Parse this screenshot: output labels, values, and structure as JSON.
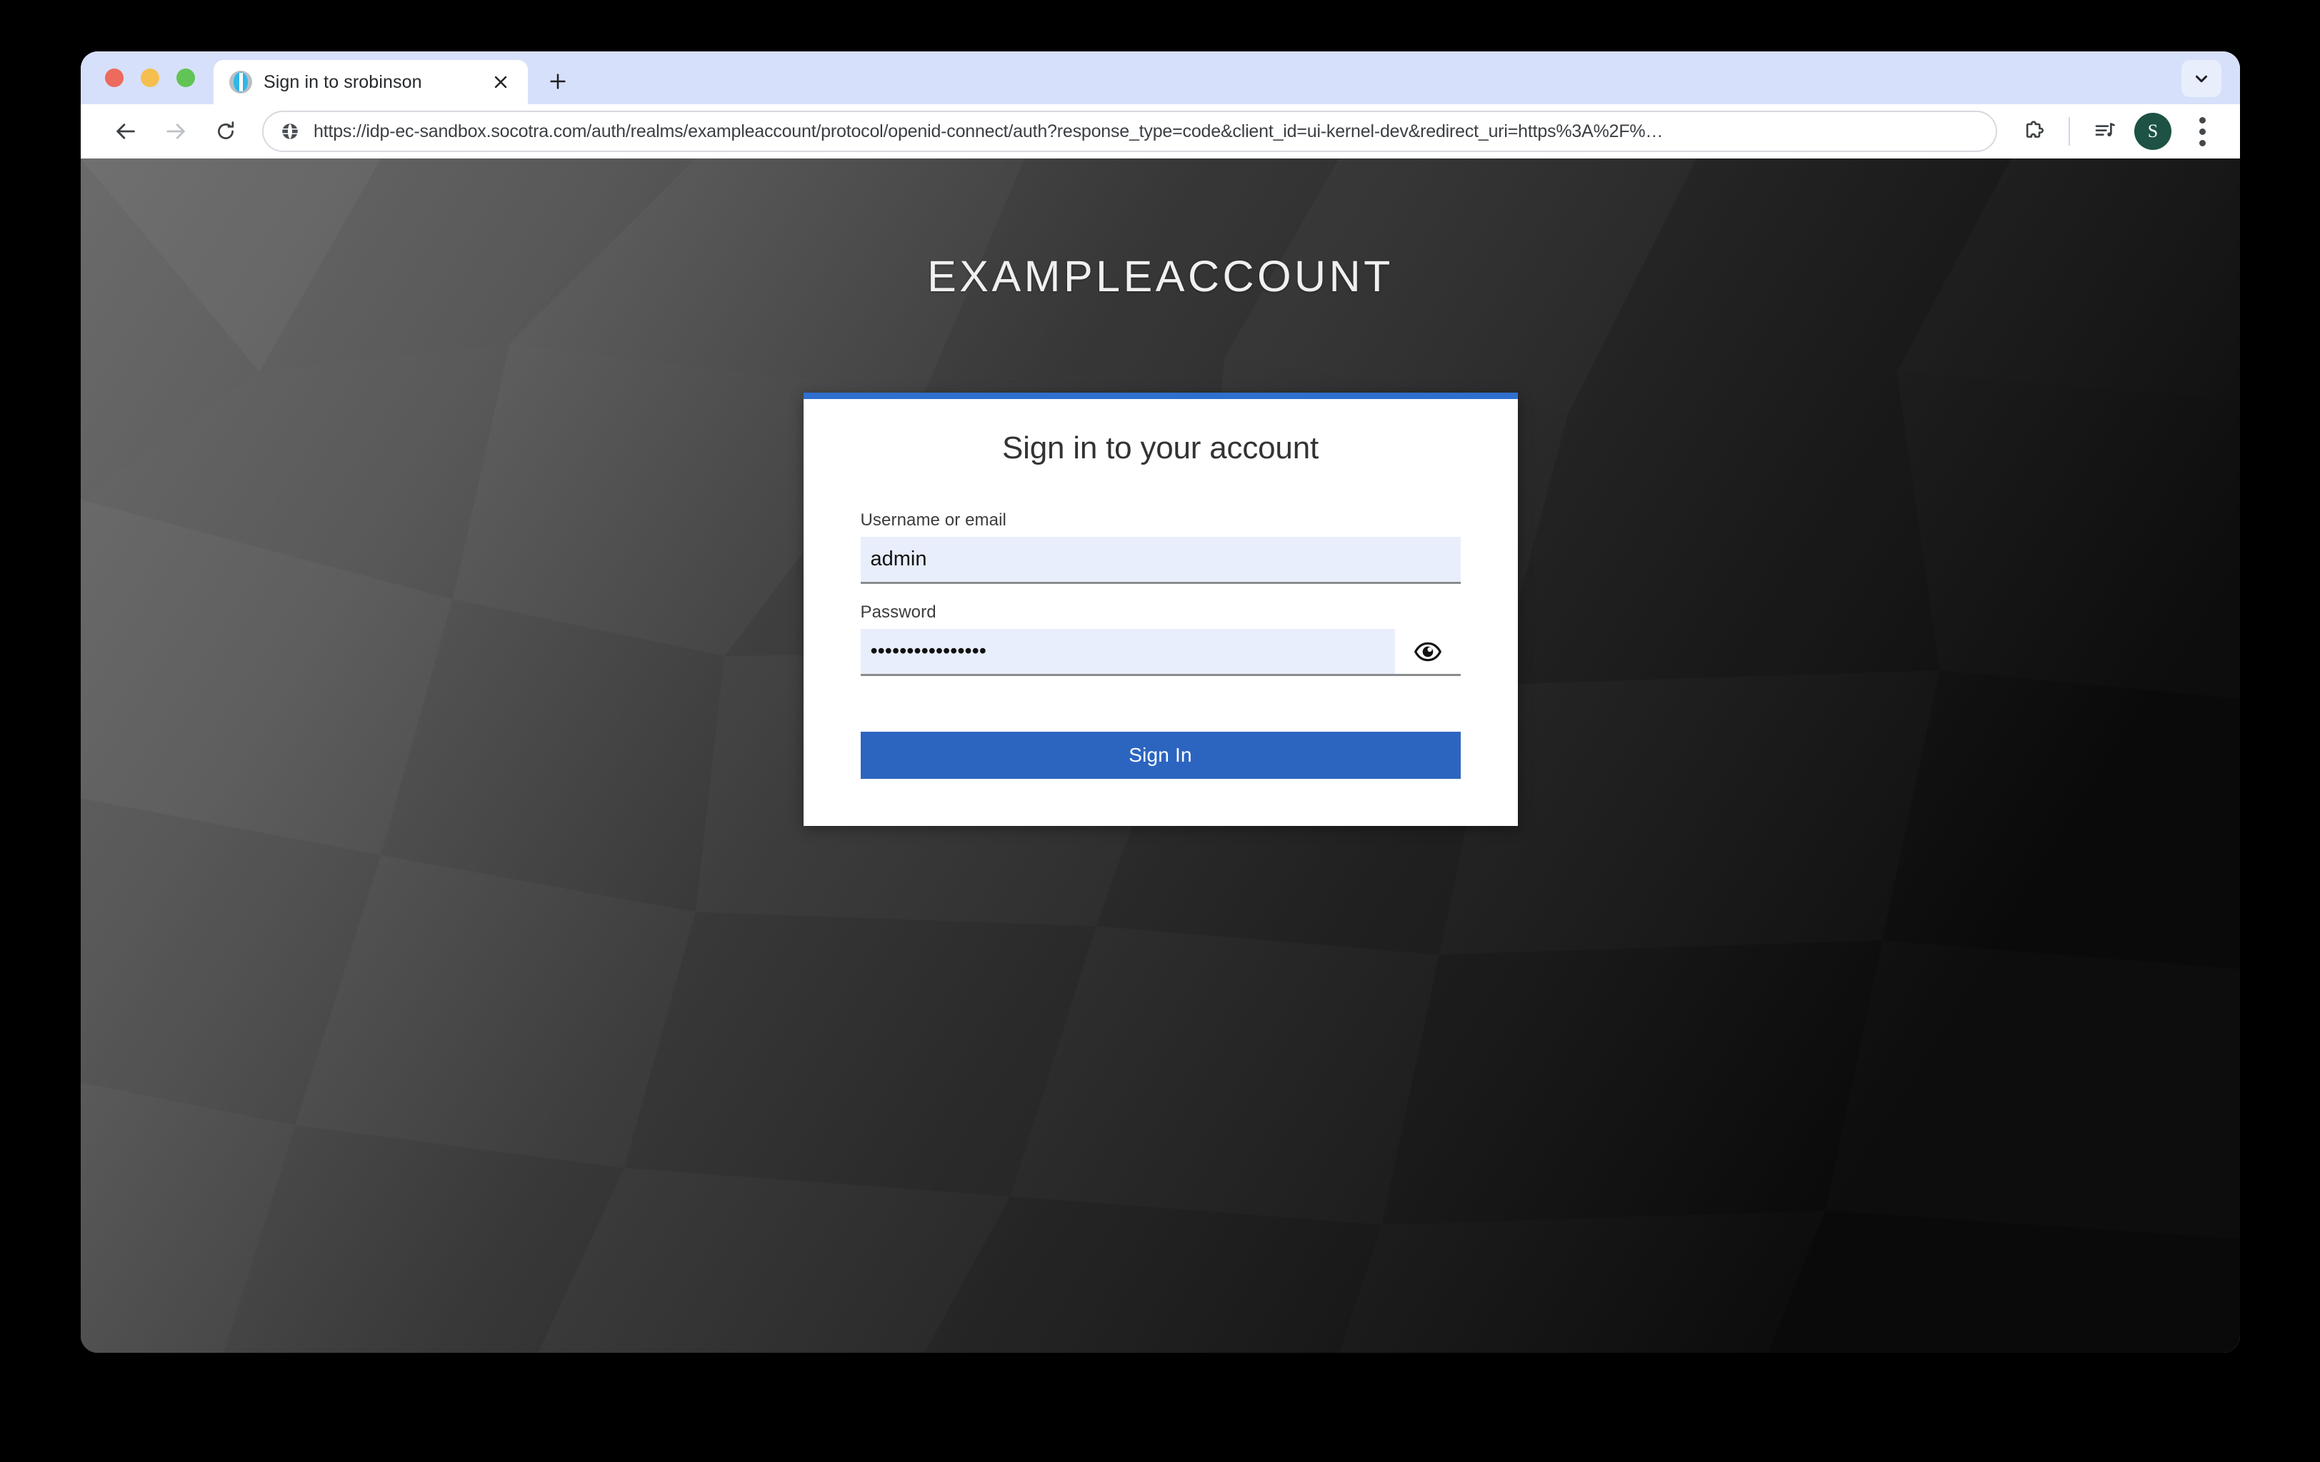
{
  "window": {
    "traffic_lights": [
      "close",
      "minimize",
      "maximize"
    ]
  },
  "tab_strip": {
    "tab": {
      "title": "Sign in to srobinson",
      "favicon": "keycloak-favicon",
      "close_label": "×"
    },
    "new_tab_label": "+",
    "tab_list_icon": "chevron-down-icon"
  },
  "toolbar": {
    "back_icon": "arrow-left-icon",
    "forward_icon": "arrow-right-icon",
    "reload_icon": "reload-icon",
    "site_info_icon": "globe-icon",
    "url": "https://idp-ec-sandbox.socotra.com/auth/realms/exampleaccount/protocol/openid-connect/auth?response_type=code&client_id=ui-kernel-dev&redirect_uri=https%3A%2F%…",
    "url_placeholder": "Search Google or type a URL",
    "extensions_icon": "puzzle-piece-icon",
    "media_icon": "media-playlist-icon",
    "avatar_initial": "S",
    "avatar_color": "#1d5245",
    "menu_icon": "three-dot-menu-icon"
  },
  "page": {
    "brand_title": "EXAMPLEACCOUNT",
    "background": {
      "type": "low-poly-triangles",
      "color_left": "#6f6f6f",
      "color_right": "#0c0c0c"
    },
    "card": {
      "accent_color": "#2f6fce",
      "heading": "Sign in to your account",
      "username": {
        "label": "Username or email",
        "value": "admin",
        "placeholder": ""
      },
      "password": {
        "label": "Password",
        "value": "••••••••••••••••",
        "placeholder": "",
        "toggle_icon": "eye-icon"
      },
      "submit": {
        "label": "Sign In",
        "color": "#2c65c0"
      }
    }
  }
}
